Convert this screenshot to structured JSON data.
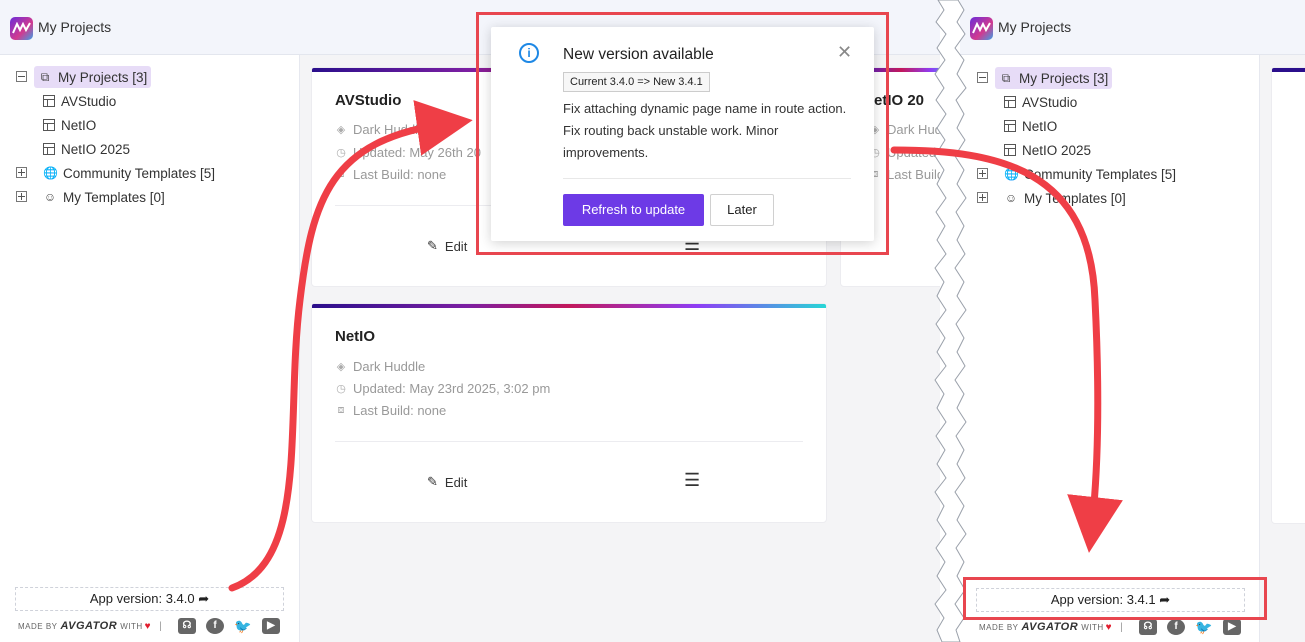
{
  "left": {
    "app_title": "My Projects",
    "tree": [
      {
        "toggle": "minus",
        "label": "My Projects [3]",
        "icon": "sitemap-icon",
        "selected": true
      },
      {
        "label": "AVStudio",
        "icon": "page-icon"
      },
      {
        "label": "NetIO",
        "icon": "page-icon"
      },
      {
        "label": "NetIO 2025",
        "icon": "page-icon"
      },
      {
        "toggle": "plus",
        "label": "Community Templates [5]",
        "icon": "globe-icon"
      },
      {
        "toggle": "plus",
        "label": "My Templates [0]",
        "icon": "user-icon"
      }
    ],
    "cards": [
      {
        "title": "AVStudio",
        "theme": "Dark Huddle",
        "updated": "Updated: May 26th 20",
        "build": "Last Build: none",
        "edit": "Edit"
      },
      {
        "title": "NetIO",
        "theme": "Dark Huddle",
        "updated": "Updated: May 23rd 2025, 3:02 pm",
        "build": "Last Build: none",
        "edit": "Edit"
      },
      {
        "title": "etIO 20",
        "theme": "Dark Huddle",
        "updated": "Updated",
        "build": "Last Build"
      }
    ],
    "app_version": "App version: 3.4.0",
    "made_by": "MADE BY",
    "brand": "AVGATOR",
    "with": "WITH"
  },
  "popup": {
    "title": "New version available",
    "version_tag": "Current 3.4.0 => New 3.4.1",
    "body": "Fix attaching dynamic page name in route action. Fix routing back unstable work. Minor improvements.",
    "refresh_label": "Refresh to update",
    "later_label": "Later"
  },
  "right": {
    "app_title": "My Projects",
    "tree": [
      {
        "toggle": "minus",
        "label": "My Projects [3]",
        "icon": "sitemap-icon",
        "selected": true
      },
      {
        "label": "AVStudio",
        "icon": "page-icon"
      },
      {
        "label": "NetIO",
        "icon": "page-icon"
      },
      {
        "label": "NetIO 2025",
        "icon": "page-icon"
      },
      {
        "toggle": "plus",
        "label": "Community Templates [5]",
        "icon": "globe-icon"
      },
      {
        "toggle": "plus",
        "label": "My Templates [0]",
        "icon": "user-icon"
      }
    ],
    "app_version": "App version: 3.4.1",
    "made_by": "MADE BY",
    "brand": "AVGATOR",
    "with": "WITH"
  },
  "colors": {
    "accent": "#6d3ae6",
    "annotation": "#e8464f",
    "selected": "#e7dcf7",
    "info": "#1e88e5"
  }
}
